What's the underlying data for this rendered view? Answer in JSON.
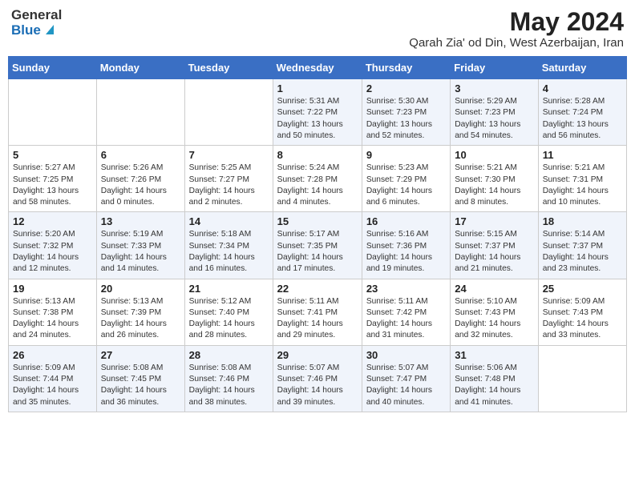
{
  "header": {
    "logo_general": "General",
    "logo_blue": "Blue",
    "month_year": "May 2024",
    "location": "Qarah Zia' od Din, West Azerbaijan, Iran"
  },
  "weekdays": [
    "Sunday",
    "Monday",
    "Tuesday",
    "Wednesday",
    "Thursday",
    "Friday",
    "Saturday"
  ],
  "weeks": [
    [
      {
        "day": "",
        "sunrise": "",
        "sunset": "",
        "daylight": ""
      },
      {
        "day": "",
        "sunrise": "",
        "sunset": "",
        "daylight": ""
      },
      {
        "day": "",
        "sunrise": "",
        "sunset": "",
        "daylight": ""
      },
      {
        "day": "1",
        "sunrise": "Sunrise: 5:31 AM",
        "sunset": "Sunset: 7:22 PM",
        "daylight": "Daylight: 13 hours and 50 minutes."
      },
      {
        "day": "2",
        "sunrise": "Sunrise: 5:30 AM",
        "sunset": "Sunset: 7:23 PM",
        "daylight": "Daylight: 13 hours and 52 minutes."
      },
      {
        "day": "3",
        "sunrise": "Sunrise: 5:29 AM",
        "sunset": "Sunset: 7:23 PM",
        "daylight": "Daylight: 13 hours and 54 minutes."
      },
      {
        "day": "4",
        "sunrise": "Sunrise: 5:28 AM",
        "sunset": "Sunset: 7:24 PM",
        "daylight": "Daylight: 13 hours and 56 minutes."
      }
    ],
    [
      {
        "day": "5",
        "sunrise": "Sunrise: 5:27 AM",
        "sunset": "Sunset: 7:25 PM",
        "daylight": "Daylight: 13 hours and 58 minutes."
      },
      {
        "day": "6",
        "sunrise": "Sunrise: 5:26 AM",
        "sunset": "Sunset: 7:26 PM",
        "daylight": "Daylight: 14 hours and 0 minutes."
      },
      {
        "day": "7",
        "sunrise": "Sunrise: 5:25 AM",
        "sunset": "Sunset: 7:27 PM",
        "daylight": "Daylight: 14 hours and 2 minutes."
      },
      {
        "day": "8",
        "sunrise": "Sunrise: 5:24 AM",
        "sunset": "Sunset: 7:28 PM",
        "daylight": "Daylight: 14 hours and 4 minutes."
      },
      {
        "day": "9",
        "sunrise": "Sunrise: 5:23 AM",
        "sunset": "Sunset: 7:29 PM",
        "daylight": "Daylight: 14 hours and 6 minutes."
      },
      {
        "day": "10",
        "sunrise": "Sunrise: 5:21 AM",
        "sunset": "Sunset: 7:30 PM",
        "daylight": "Daylight: 14 hours and 8 minutes."
      },
      {
        "day": "11",
        "sunrise": "Sunrise: 5:21 AM",
        "sunset": "Sunset: 7:31 PM",
        "daylight": "Daylight: 14 hours and 10 minutes."
      }
    ],
    [
      {
        "day": "12",
        "sunrise": "Sunrise: 5:20 AM",
        "sunset": "Sunset: 7:32 PM",
        "daylight": "Daylight: 14 hours and 12 minutes."
      },
      {
        "day": "13",
        "sunrise": "Sunrise: 5:19 AM",
        "sunset": "Sunset: 7:33 PM",
        "daylight": "Daylight: 14 hours and 14 minutes."
      },
      {
        "day": "14",
        "sunrise": "Sunrise: 5:18 AM",
        "sunset": "Sunset: 7:34 PM",
        "daylight": "Daylight: 14 hours and 16 minutes."
      },
      {
        "day": "15",
        "sunrise": "Sunrise: 5:17 AM",
        "sunset": "Sunset: 7:35 PM",
        "daylight": "Daylight: 14 hours and 17 minutes."
      },
      {
        "day": "16",
        "sunrise": "Sunrise: 5:16 AM",
        "sunset": "Sunset: 7:36 PM",
        "daylight": "Daylight: 14 hours and 19 minutes."
      },
      {
        "day": "17",
        "sunrise": "Sunrise: 5:15 AM",
        "sunset": "Sunset: 7:37 PM",
        "daylight": "Daylight: 14 hours and 21 minutes."
      },
      {
        "day": "18",
        "sunrise": "Sunrise: 5:14 AM",
        "sunset": "Sunset: 7:37 PM",
        "daylight": "Daylight: 14 hours and 23 minutes."
      }
    ],
    [
      {
        "day": "19",
        "sunrise": "Sunrise: 5:13 AM",
        "sunset": "Sunset: 7:38 PM",
        "daylight": "Daylight: 14 hours and 24 minutes."
      },
      {
        "day": "20",
        "sunrise": "Sunrise: 5:13 AM",
        "sunset": "Sunset: 7:39 PM",
        "daylight": "Daylight: 14 hours and 26 minutes."
      },
      {
        "day": "21",
        "sunrise": "Sunrise: 5:12 AM",
        "sunset": "Sunset: 7:40 PM",
        "daylight": "Daylight: 14 hours and 28 minutes."
      },
      {
        "day": "22",
        "sunrise": "Sunrise: 5:11 AM",
        "sunset": "Sunset: 7:41 PM",
        "daylight": "Daylight: 14 hours and 29 minutes."
      },
      {
        "day": "23",
        "sunrise": "Sunrise: 5:11 AM",
        "sunset": "Sunset: 7:42 PM",
        "daylight": "Daylight: 14 hours and 31 minutes."
      },
      {
        "day": "24",
        "sunrise": "Sunrise: 5:10 AM",
        "sunset": "Sunset: 7:43 PM",
        "daylight": "Daylight: 14 hours and 32 minutes."
      },
      {
        "day": "25",
        "sunrise": "Sunrise: 5:09 AM",
        "sunset": "Sunset: 7:43 PM",
        "daylight": "Daylight: 14 hours and 33 minutes."
      }
    ],
    [
      {
        "day": "26",
        "sunrise": "Sunrise: 5:09 AM",
        "sunset": "Sunset: 7:44 PM",
        "daylight": "Daylight: 14 hours and 35 minutes."
      },
      {
        "day": "27",
        "sunrise": "Sunrise: 5:08 AM",
        "sunset": "Sunset: 7:45 PM",
        "daylight": "Daylight: 14 hours and 36 minutes."
      },
      {
        "day": "28",
        "sunrise": "Sunrise: 5:08 AM",
        "sunset": "Sunset: 7:46 PM",
        "daylight": "Daylight: 14 hours and 38 minutes."
      },
      {
        "day": "29",
        "sunrise": "Sunrise: 5:07 AM",
        "sunset": "Sunset: 7:46 PM",
        "daylight": "Daylight: 14 hours and 39 minutes."
      },
      {
        "day": "30",
        "sunrise": "Sunrise: 5:07 AM",
        "sunset": "Sunset: 7:47 PM",
        "daylight": "Daylight: 14 hours and 40 minutes."
      },
      {
        "day": "31",
        "sunrise": "Sunrise: 5:06 AM",
        "sunset": "Sunset: 7:48 PM",
        "daylight": "Daylight: 14 hours and 41 minutes."
      },
      {
        "day": "",
        "sunrise": "",
        "sunset": "",
        "daylight": ""
      }
    ]
  ]
}
